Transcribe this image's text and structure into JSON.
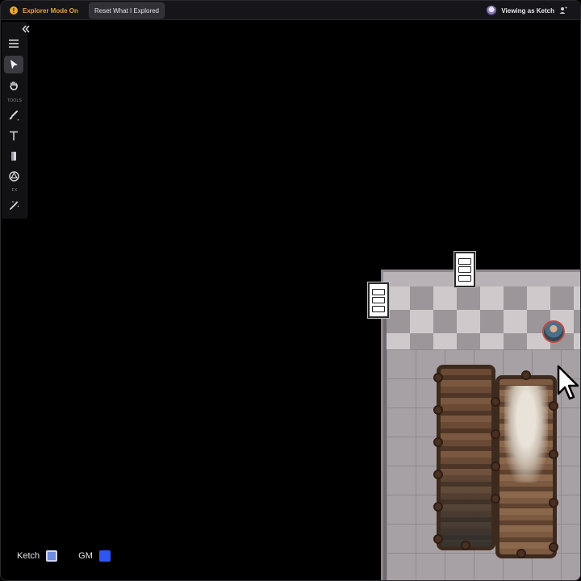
{
  "topbar": {
    "explorer_mode_label": "Explorer Mode On",
    "explorer_icon": "!",
    "reset_button_label": "Reset What I Explored",
    "viewing_as_label": "Viewing as Ketch"
  },
  "toolbar": {
    "tools_section_label": "TOOLS",
    "fx_section_label": "FX",
    "items": [
      {
        "name": "menu-icon"
      },
      {
        "name": "select-arrow-icon",
        "active": true
      },
      {
        "name": "pan-hand-icon"
      },
      {
        "name": "brush-icon"
      },
      {
        "name": "text-icon"
      },
      {
        "name": "fog-eraser-icon"
      },
      {
        "name": "dice-icon"
      },
      {
        "name": "magic-wand-icon"
      }
    ]
  },
  "legend": {
    "items": [
      {
        "label": "Ketch",
        "color": "#6f8ce0"
      },
      {
        "label": "GM",
        "color": "#2e56f0"
      }
    ]
  },
  "colors": {
    "accent_orange": "#e6a23a",
    "background": "#000000",
    "topbar": "#16161a"
  }
}
